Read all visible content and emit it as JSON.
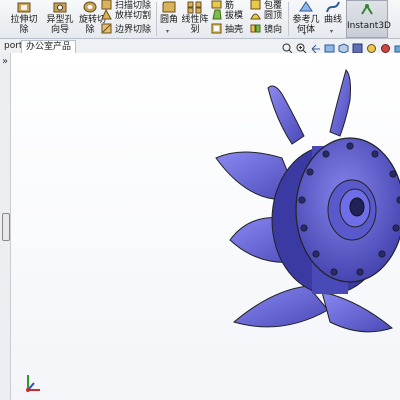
{
  "ribbon": {
    "extrude_cut": "拉伸切\n除",
    "hole_wizard": "异型孔\n向导",
    "revolve_cut": "旋转切\n除",
    "sweep_cut": "扫描切除",
    "loft_cut": "放样切割",
    "boundary_cut": "边界切除",
    "fillet": "圆角",
    "linear_pattern": "线性阵\n列",
    "rib": "筋",
    "draft": "拔模",
    "shell": "抽壳",
    "wrap": "包覆",
    "intersect": "圆顶",
    "mirror": "镜向",
    "ref_geometry": "参考几\n何体",
    "curves": "曲线",
    "instant3d": "Instant3D"
  },
  "tabs": {
    "export": "port",
    "office": "办公室产品"
  },
  "leftbar": {
    "expand": "»"
  },
  "colors": {
    "fan_body": "#6f6ee8",
    "fan_shadow": "#3b3aa3",
    "canvas_bg": "#f3f5f9"
  }
}
